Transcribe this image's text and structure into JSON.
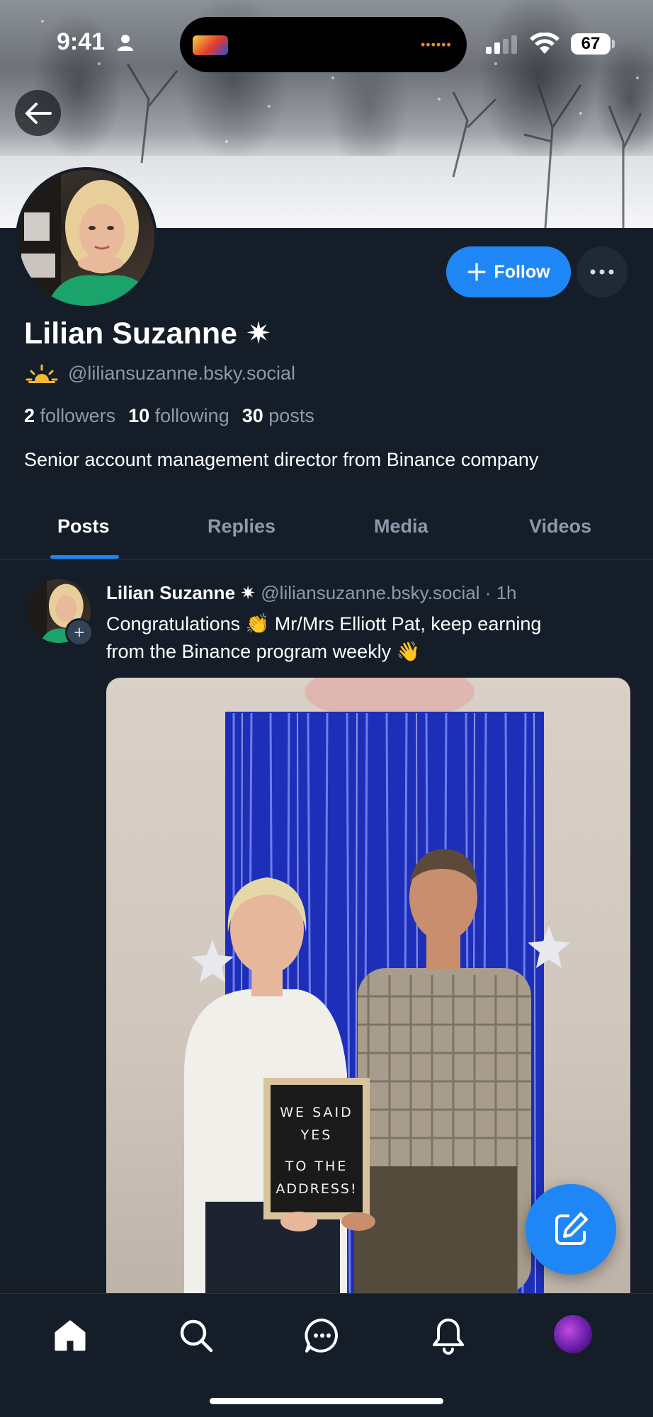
{
  "status_bar": {
    "time": "9:41",
    "battery": "67",
    "island_dots": "••••••"
  },
  "header": {
    "back_icon": "arrow-left-icon"
  },
  "profile": {
    "display_name": "Lilian Suzanne",
    "verified_glyph": "✷",
    "handle": "@liliansuzanne.bsky.social",
    "follow_label": "Follow",
    "followers_count": "2",
    "followers_label": "followers",
    "following_count": "10",
    "following_label": "following",
    "posts_count": "30",
    "posts_label": "posts",
    "bio": "Senior account management director from Binance company"
  },
  "tabs": [
    {
      "label": "Posts",
      "active": true
    },
    {
      "label": "Replies",
      "active": false
    },
    {
      "label": "Media",
      "active": false
    },
    {
      "label": "Videos",
      "active": false
    }
  ],
  "post": {
    "author": "Lilian Suzanne ✷",
    "handle": "@liliansuzanne.bsky.social",
    "separator": "·",
    "time": "1h",
    "text_line1": "Congratulations 👏 Mr/Mrs Elliott Pat, keep earning",
    "text_line2": "from the Binance program weekly 👋",
    "sign_line1": "WE SAID",
    "sign_line2": "YES",
    "sign_line3": "TO THE",
    "sign_line4": "ADDRESS!"
  },
  "bottom_nav": {
    "items": [
      "home-icon",
      "search-icon",
      "chat-icon",
      "bell-icon",
      "profile-avatar"
    ]
  },
  "colors": {
    "background": "#151d28",
    "accent": "#1f87f5",
    "muted_text": "#8d99ab"
  }
}
